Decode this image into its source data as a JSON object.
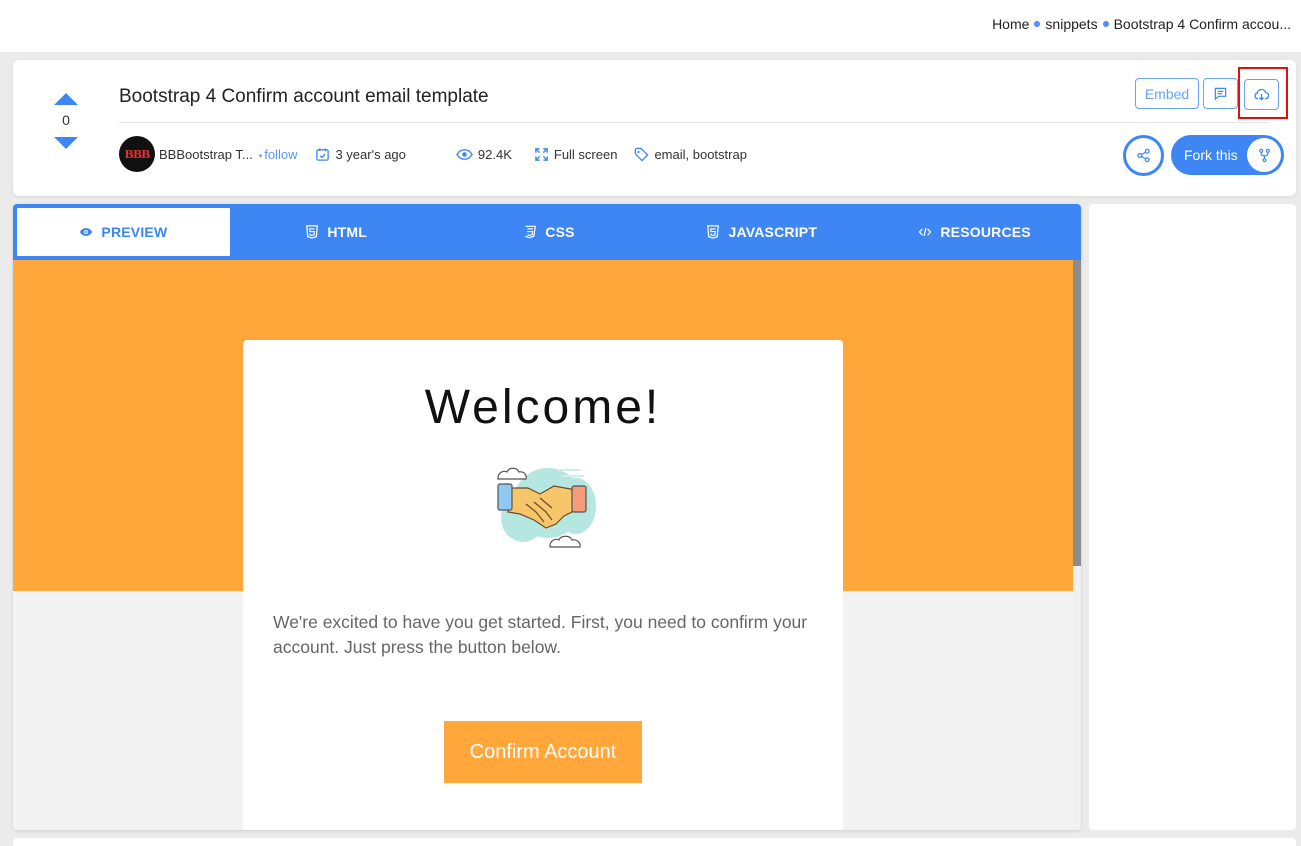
{
  "breadcrumb": {
    "items": [
      "Home",
      "snippets",
      "Bootstrap 4 Confirm accou..."
    ]
  },
  "snippet": {
    "title": "Bootstrap 4 Confirm account email template",
    "votes": "0",
    "author": "BBBootstrap T...",
    "avatar_text": "BBB",
    "follow_label": "follow",
    "age": "3 year's ago",
    "views": "92.4K",
    "fullscreen_label": "Full screen",
    "tags": "email, bootstrap"
  },
  "actions": {
    "embed_label": "Embed",
    "fork_label": "Fork this",
    "icons": [
      "comment-icon",
      "cloud-download-icon",
      "share-icon",
      "fork-icon"
    ]
  },
  "tabs": [
    {
      "label": "PREVIEW",
      "icon": "eye-icon",
      "active": true
    },
    {
      "label": "HTML",
      "icon": "html5-icon",
      "active": false
    },
    {
      "label": "CSS",
      "icon": "css3-icon",
      "active": false
    },
    {
      "label": "JAVASCRIPT",
      "icon": "js-icon",
      "active": false
    },
    {
      "label": "RESOURCES",
      "icon": "code-icon",
      "active": false
    }
  ],
  "preview": {
    "heading": "Welcome!",
    "body": "We're excited to have you get started. First, you need to confirm your account. Just press the button below.",
    "button_label": "Confirm Account"
  },
  "colors": {
    "accent": "#3d86f4",
    "orange": "#ffa73b",
    "highlight": "#e01010"
  }
}
